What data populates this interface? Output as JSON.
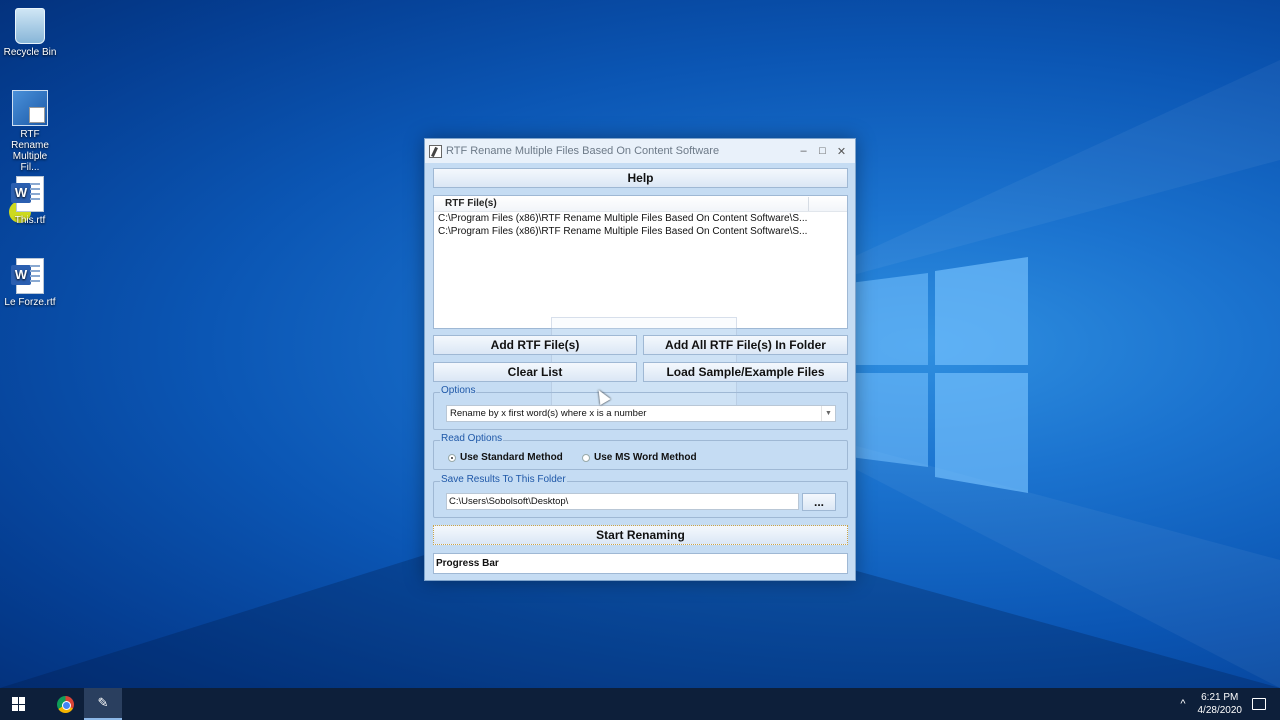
{
  "desktop": {
    "icons": [
      {
        "label": "Recycle Bin",
        "icon": "recycle-bin-icon"
      },
      {
        "label": "RTF Rename Multiple Fil...",
        "icon": "app-shortcut-icon"
      },
      {
        "label": "This.rtf",
        "icon": "word-doc-icon"
      },
      {
        "label": "Le Forze.rtf",
        "icon": "word-doc-icon"
      }
    ]
  },
  "window": {
    "title": "RTF Rename Multiple Files Based On Content Software",
    "controls": {
      "minimize": "–",
      "maximize": "□",
      "close": "✕"
    },
    "help_label": "Help",
    "list": {
      "header": "RTF File(s)",
      "rows": [
        "C:\\Program Files (x86)\\RTF Rename Multiple Files Based On Content Software\\S...",
        "C:\\Program Files (x86)\\RTF Rename Multiple Files Based On Content Software\\S..."
      ]
    },
    "buttons": {
      "add_files": "Add RTF File(s)",
      "add_folder": "Add All RTF File(s) In Folder",
      "clear_list": "Clear List",
      "load_sample": "Load Sample/Example Files",
      "browse": "...",
      "start": "Start Renaming"
    },
    "options": {
      "legend": "Options",
      "selected": "Rename by x first word(s) where x is a number"
    },
    "read_options": {
      "legend": "Read Options",
      "standard": "Use Standard Method",
      "msword": "Use MS Word Method",
      "selected": "standard"
    },
    "save_folder": {
      "legend": "Save Results To This Folder",
      "value": "C:\\Users\\Sobolsoft\\Desktop\\"
    },
    "progress_label": "Progress Bar"
  },
  "taskbar": {
    "time": "6:21 PM",
    "date": "4/28/2020",
    "tray_chevron": "^",
    "notification_icon": "notification-icon"
  }
}
